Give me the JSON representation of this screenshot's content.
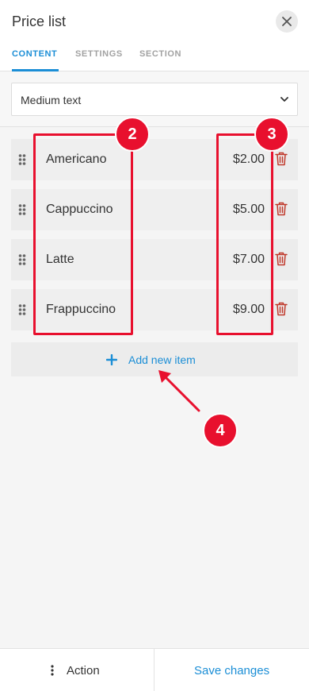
{
  "panel": {
    "title": "Price list"
  },
  "tabs": [
    {
      "label": "CONTENT",
      "active": true
    },
    {
      "label": "SETTINGS",
      "active": false
    },
    {
      "label": "SECTION",
      "active": false
    }
  ],
  "text_size_select": {
    "value": "Medium text"
  },
  "items": [
    {
      "name": "Americano",
      "price": "$2.00"
    },
    {
      "name": "Cappuccino",
      "price": "$5.00"
    },
    {
      "name": "Latte",
      "price": "$7.00"
    },
    {
      "name": "Frappuccino",
      "price": "$9.00"
    }
  ],
  "add_item": {
    "label": "Add new item"
  },
  "annotations": {
    "names_badge": "2",
    "prices_badge": "3",
    "add_badge": "4"
  },
  "footer": {
    "action_label": "Action",
    "save_label": "Save changes"
  },
  "colors": {
    "accent": "#1b8ed6",
    "annotation": "#e8102e",
    "delete_icon": "#c0392b",
    "panel_bg": "#f5f5f5"
  },
  "icons": {
    "close": "close-icon",
    "chevron": "chevron-down-icon",
    "drag": "drag-handle-icon",
    "delete": "trash-icon",
    "add": "plus-icon",
    "more": "more-vertical-icon"
  }
}
